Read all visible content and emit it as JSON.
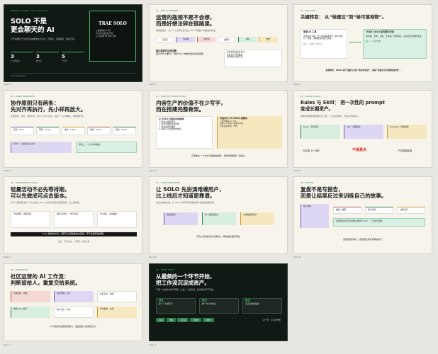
{
  "slides": [
    {
      "tag": "INTERNAL SHARE · TRAE SOLO OPS",
      "title": "SOLO 不是\n更会聊天的 AI",
      "sub": "它开始像生产力运营系统那样执行任务、可继续、可被调度、持续沉淀。",
      "stats": [
        {
          "num": "3",
          "label": "个关键转变"
        },
        {
          "num": "3",
          "label": "套方法"
        },
        {
          "num": "5",
          "label": "个阶段"
        }
      ],
      "badge": "TRAE SOLO",
      "badge_text": "从会聊天的 AI 到\n可以托付给的执行者，\n从“对话框”到“执行引擎”",
      "footer_left": "SOLO 运营实践分享",
      "page": "Page 01"
    },
    {
      "tag": "01 · WHY IT MATTERS",
      "title": "运营的瓶颈不是不会想，\n而是好想法碎在链路里。",
      "sub": "运营链路长：几十个小工具各自为战，每一环都要人来搬运和衔接。",
      "chips": [
        "写提示",
        "找素材",
        "改文案",
        "出图片",
        "排版",
        "发布"
      ],
      "left_head": "真正值得关注的问题：",
      "left_text": "用户为什么要为了“拆好卡片”去重新组织这些流程？",
      "right_items": [
        "重复操作消耗注意力",
        "信息在工具间丢失",
        "结果难以复用沉淀"
      ],
      "page": "Page 02"
    },
    {
      "tag": "02 · KEY SHIFT",
      "title": "关键转变：  从“给建议”到“给可落地物”。",
      "left_title": "普通 AI 工具",
      "left_text": "告诉你怎么做，给一段思路或参考，剩下的执行、整理、落地都要你自己完成。",
      "left_hint": "输入 → 输出一段文字",
      "right_title": "TRAE SOLO 能完整交付的",
      "right_text": "把流程、结构、文档、文件等一次组织好，直接给出能用的东西。",
      "right_hint": "输入 → 可交付物",
      "bottom": "运营角色：SOLO 的产品能力不是“更好的对话”，而是“直接交付可落地的结果”。",
      "page": "Page 03"
    },
    {
      "tag": "03 · WORK PRINCIPLES",
      "title": "协作原则只有两条：\n先对齐再执行，先小样再放大。",
      "sub": "先把目标、边界、素材对齐，再让 SOLO 动手；先做一个小样确认，再批量扩展。",
      "cards": [
        "目标 · Goal",
        "范围 · Scope",
        "素材 · Input",
        "标准 · Check",
        "验收 · Done"
      ],
      "left_box": "原则一：复杂任务先对齐",
      "right_box": "原则二：一次小样先确认",
      "page": "Page 04"
    },
    {
      "tag": "04 · CONTENT PRODUCTION",
      "title": "内容生产的价值不在少写字，\n而在搭建完整骨架。",
      "left_head": "让 SOLO 先搭出内容结构",
      "left_items": [
        "1. 拆出主题和受众",
        "2. 生成大纲和段落结构",
        "3. 填充案例与数据",
        "4. 输出可直接发布的成稿"
      ],
      "right_head": "传统写作 VS SOLO 搭骨架",
      "right_items": [
        "一篇文章写 3 小时",
        "骨架 10 分钟，填充半小时",
        "可重复复用同一骨架"
      ],
      "bottom": "它更像是“一个执行力超强的助理”，能帮你把结构一次搭好。",
      "page": "Page 05"
    },
    {
      "tag": "05 · RULES & SKILL",
      "title": "Rules 与 Skill：  把一次性的 prompt\n变成长期资产。",
      "sub": "把常用的规则和流程沉淀下来，下次直接调用，不再从零写提示。",
      "cards": [
        "Rules · 写作规范",
        "Skill · 封面生成",
        "Template · 周报模板"
      ],
      "left_label": "今天省 10 分钟",
      "mid_label": "不是重点",
      "right_label": "下次还能复用",
      "page": "Page 06"
    },
    {
      "tag": "06 · LIGHTWEIGHT TASKS",
      "title": "轻量活动不必先等排期，\n可以先做成可点击版本。",
      "sub": "对于小型运营活动，可以直接让 SOLO 生成可交互的页面原型，先上线验证。",
      "cards": [
        "活动规则 · 领取页面",
        "抽奖九宫格 · 一键可交互",
        "H5 报名 · 表单收集"
      ],
      "bar": "Code 模式的价值：运营可以自助做出交互版，而不是等研发排期。",
      "bottom": "适合：节日活动、小调研、内部工具",
      "page": "Page 07"
    },
    {
      "tag": "07 · USER OPERATIONS",
      "title": "让 SOLO 先扮演难缠用户，\n比上线后才知道更靠谱。",
      "sub": "在正式发布之前，让 SOLO 扮演不同类型的用户提出质疑和反馈。",
      "cards": [
        "挑剔型用户",
        "新人困惑型用户",
        "价格敏感型用户"
      ],
      "bottom": "它可以同时扮演好几种用户，帮你提前发现问题。",
      "page": "Page 08"
    },
    {
      "tag": "08 · REVIEW",
      "title": "复盘不是写报告，\n而是让结果反过来训练自己的故事。",
      "left_box": "输入材料",
      "right_boxes": [
        "数据 / 截图",
        "用户反馈",
        "过程记录"
      ],
      "mid_bar": "最终把复盘沉淀为新的“规则与 Skill”，下次执行更稳。",
      "bottom": "运营复盘的核心：把经验变成可调用的资产。",
      "page": "Page 09"
    },
    {
      "tag": "09 · WORKFLOW",
      "title": "社区运营的 AI 工作流：\n判断留给人，重复交给系统。",
      "cards": [
        "内容选题 · 判断",
        "素材整理 · 执行",
        "社区互动 · 监测",
        "数据 Tabs 报表",
        "用户分层 · 标签",
        "活动策划 · 复用"
      ],
      "bottom": "AI 不会替代运营的判断力，但会接管大量重复工作。",
      "page": "Page 10"
    },
    {
      "tag": "10 · START TODAY",
      "title": "从最频的一个环节开始，\n把工作流沉淀成资产。",
      "sub": "不要一次性重构所有流程，先挑一个最高频、最重复的环节开始。",
      "steps": [
        {
          "num": "01",
          "label": "选一个高频环节"
        },
        {
          "num": "02",
          "label": "做一次小样验证"
        },
        {
          "num": "03",
          "label": "沉淀为规则模板"
        }
      ],
      "chips": [
        "高频",
        "重复",
        "可沉淀",
        "可复用",
        "可交付"
      ],
      "bottom_right": "第一步：今天就开始",
      "page": "Page 11"
    }
  ]
}
